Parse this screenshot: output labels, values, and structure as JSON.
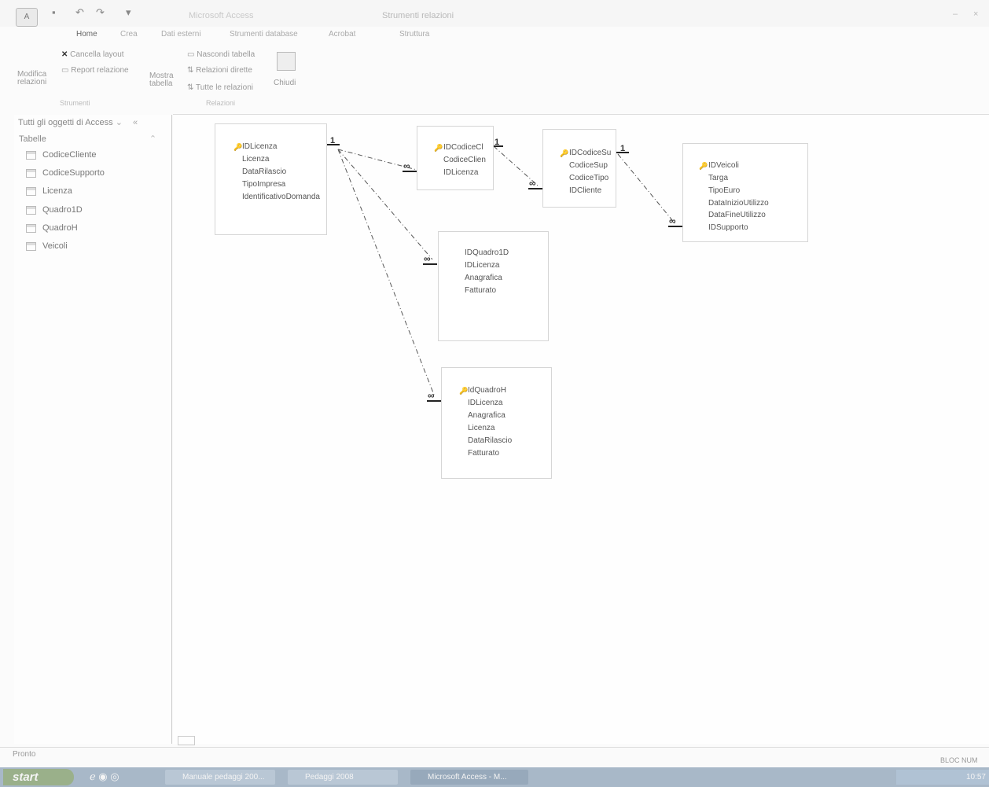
{
  "window": {
    "app_button_label": "A",
    "title": "Microsoft Access",
    "context_title": "Strumenti relazioni",
    "minimize": "–",
    "close": "×"
  },
  "ribbon": {
    "tabs": [
      "Home",
      "Crea",
      "Dati esterni",
      "Strumenti database",
      "Acrobat",
      "Struttura"
    ],
    "tools": {
      "modify_relations": "Modifica relazioni",
      "clear_layout": "Cancella layout",
      "relationship_report": "Report relazione",
      "show_table": "Mostra tabella",
      "hide_table": "Nascondi tabella",
      "direct_relations": "Relazioni dirette",
      "all_relations": "Tutte le relazioni",
      "close": "Chiudi",
      "group_tools": "Strumenti",
      "group_relations": "Relazioni"
    }
  },
  "nav": {
    "header": "Tutti gli oggetti di Access",
    "group": "Tabelle",
    "items": [
      "CodiceCliente",
      "CodiceSupporto",
      "Licenza",
      "Quadro1D",
      "QuadroH",
      "Veicoli"
    ]
  },
  "tables": {
    "licenza": {
      "fields": [
        "IDLicenza",
        "Licenza",
        "DataRilascio",
        "TipoImpresa",
        "IdentificativoDomanda"
      ]
    },
    "codicecliente": {
      "fields": [
        "IDCodiceCl",
        "CodiceClien",
        "IDLicenza"
      ]
    },
    "codicesupporto": {
      "fields": [
        "IDCodiceSu",
        "CodiceSup",
        "CodiceTipo",
        "IDCliente"
      ]
    },
    "veicoli": {
      "fields": [
        "IDVeicoli",
        "Targa",
        "TipoEuro",
        "DataInizioUtilizzo",
        "DataFineUtilizzo",
        "IDSupporto"
      ]
    },
    "quadro1d": {
      "fields": [
        "IDQuadro1D",
        "IDLicenza",
        "Anagrafica",
        "Fatturato"
      ]
    },
    "quadroh": {
      "fields": [
        "IdQuadroH",
        "IDLicenza",
        "Anagrafica",
        "Licenza",
        "DataRilascio",
        "Fatturato"
      ]
    }
  },
  "relations": {
    "one": "1",
    "many": "∞"
  },
  "status": {
    "left": "Pronto",
    "right": "BLOC NUM"
  },
  "taskbar": {
    "start": "start",
    "tasks": [
      "Manuale pedaggi 200...",
      "Pedaggi 2008",
      "Microsoft Access - M..."
    ],
    "clock": "10:57"
  }
}
